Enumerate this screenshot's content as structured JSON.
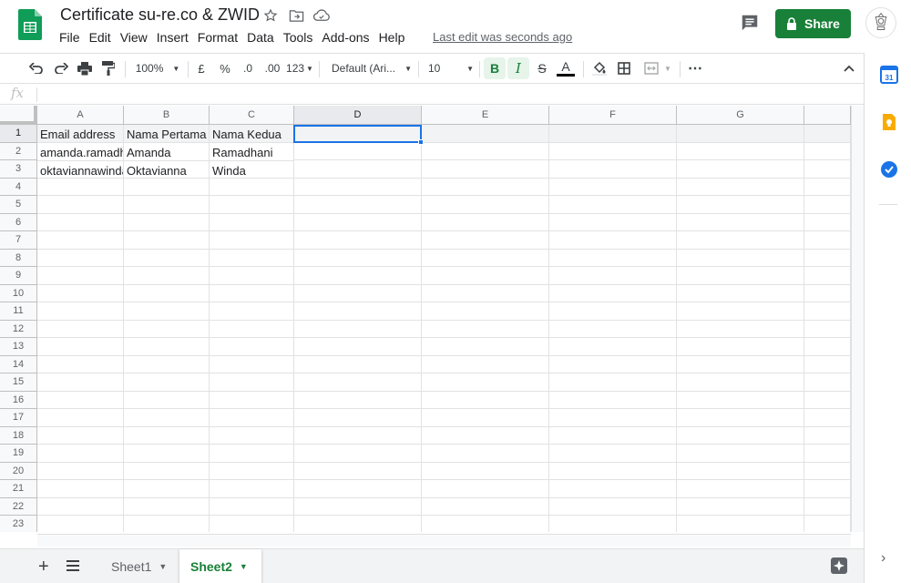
{
  "app": {
    "title": "Certificate su-re.co & ZWID",
    "last_edit": "Last edit was seconds ago",
    "share_label": "Share",
    "brand_color": "#188038",
    "accent_color": "#1a73e8"
  },
  "menu": [
    "File",
    "Edit",
    "View",
    "Insert",
    "Format",
    "Data",
    "Tools",
    "Add-ons",
    "Help"
  ],
  "toolbar": {
    "zoom": "100%",
    "currency": "£",
    "percent": "%",
    "decrease_decimal": ".0",
    "increase_decimal": ".00",
    "more_formats": "123",
    "font": "Default (Ari...",
    "font_size": "10",
    "bold": "B",
    "italic": "I",
    "strikethrough": "S",
    "text_color": "A",
    "icons": [
      "undo-icon",
      "redo-icon",
      "print-icon",
      "paint-format-icon",
      "fill-color-icon",
      "borders-icon",
      "merge-cells-icon",
      "more-icon",
      "collapse-icon"
    ]
  },
  "formula": {
    "label": "fx",
    "value": ""
  },
  "grid": {
    "columns": [
      "A",
      "B",
      "C",
      "D",
      "E",
      "F",
      "G"
    ],
    "rows": [
      "1",
      "2",
      "3",
      "4",
      "5",
      "6",
      "7",
      "8",
      "9",
      "10",
      "11",
      "12",
      "13",
      "14",
      "15",
      "16",
      "17",
      "18",
      "19",
      "20",
      "21",
      "22",
      "23"
    ],
    "selected_cell": "D1",
    "cells": [
      [
        "Email address",
        "Nama Pertama",
        "Nama Kedua"
      ],
      [
        "amanda.ramadha",
        "Amanda",
        "Ramadhani"
      ],
      [
        "oktaviannawinda",
        "Oktavianna",
        "Winda"
      ]
    ]
  },
  "sheets": {
    "tabs": [
      "Sheet1",
      "Sheet2"
    ],
    "active": "Sheet2"
  },
  "side_panel": {
    "calendar_day": "31",
    "icons": [
      "calendar-icon",
      "keep-icon",
      "tasks-icon"
    ]
  }
}
